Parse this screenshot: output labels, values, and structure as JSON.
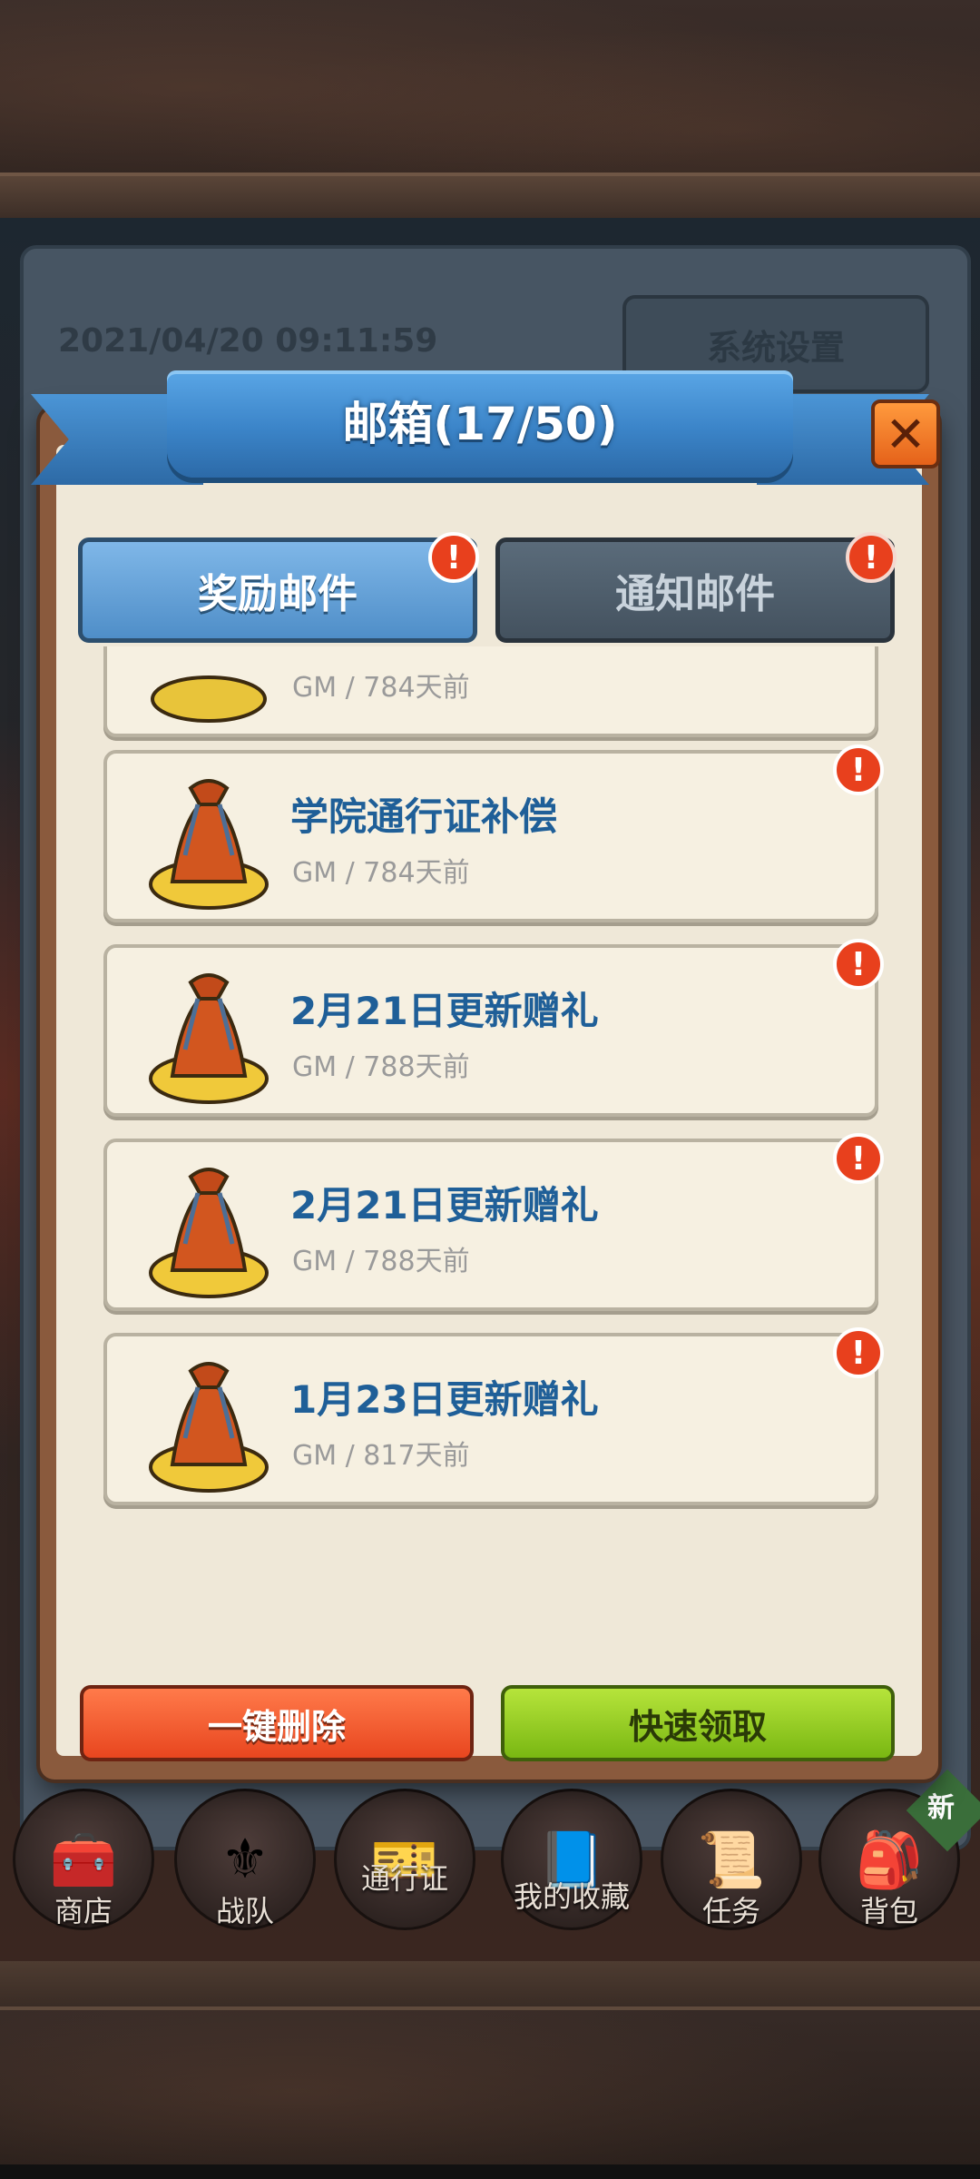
{
  "background": {
    "date_time": "2021/04/20 09:11:59",
    "settings_button": "系统设置"
  },
  "mailbox": {
    "title": "邮箱(17/50)",
    "close": "✕",
    "tabs": [
      {
        "label": "奖励邮件",
        "active": true,
        "alert": "!"
      },
      {
        "label": "通知邮件",
        "active": false,
        "alert": "!"
      }
    ],
    "mails": [
      {
        "title": "",
        "meta": "GM / 784天前",
        "partial": true
      },
      {
        "title": "学院通行证补偿",
        "meta": "GM / 784天前",
        "alert": "!"
      },
      {
        "title": "2月21日更新赠礼",
        "meta": "GM / 788天前",
        "alert": "!"
      },
      {
        "title": "2月21日更新赠礼",
        "meta": "GM / 788天前",
        "alert": "!"
      },
      {
        "title": "1月23日更新赠礼",
        "meta": "GM / 817天前",
        "alert": "!"
      }
    ],
    "delete_all": "一键删除",
    "quick_claim": "快速领取"
  },
  "bottom_nav": {
    "items": [
      {
        "label": "商店",
        "icon": "shop-icon"
      },
      {
        "label": "战队",
        "icon": "team-banner-icon"
      },
      {
        "label": "通行证",
        "icon": "pass-icon"
      },
      {
        "label": "我的收藏",
        "icon": "collection-book-icon"
      },
      {
        "label": "任务",
        "icon": "task-scroll-icon"
      },
      {
        "label": "背包",
        "icon": "backpack-icon"
      }
    ],
    "new_badge": "新"
  },
  "colors": {
    "accent_blue": "#3b84c8",
    "alert_red": "#e8401d",
    "delete_orange": "#e8461f",
    "claim_green": "#79b712",
    "title_blue": "#1f5f98"
  }
}
